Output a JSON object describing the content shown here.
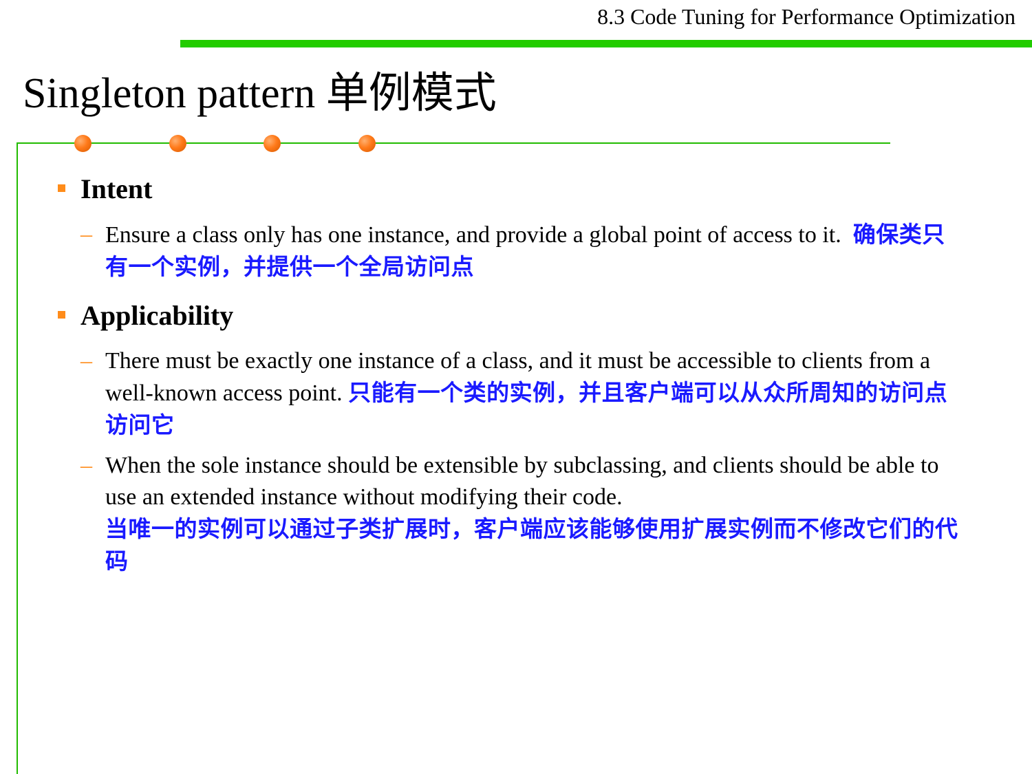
{
  "header": {
    "section_title": "8.3 Code Tuning for Performance Optimization"
  },
  "title": "Singleton pattern 单例模式",
  "colors": {
    "accent_green": "#22cc00",
    "bullet_orange": "#ff8c1a",
    "chinese_text_blue": "#1a1aff"
  },
  "sections": [
    {
      "heading": "Intent",
      "items": [
        {
          "en": "Ensure a class only has one instance, and provide a global point of access to it.",
          "zh": "确保类只有一个实例，并提供一个全局访问点"
        }
      ]
    },
    {
      "heading": "Applicability",
      "items": [
        {
          "en": "There must be exactly one instance of a class, and it must be accessible to clients from a well-known access point.",
          "zh": "只能有一个类的实例，并且客户端可以从众所周知的访问点访问它"
        },
        {
          "en": "When the sole instance should be extensible by subclassing, and clients should be able to use an extended instance without modifying their code.",
          "zh": "当唯一的实例可以通过子类扩展时，客户端应该能够使用扩展实例而不修改它们的代码"
        }
      ]
    }
  ]
}
